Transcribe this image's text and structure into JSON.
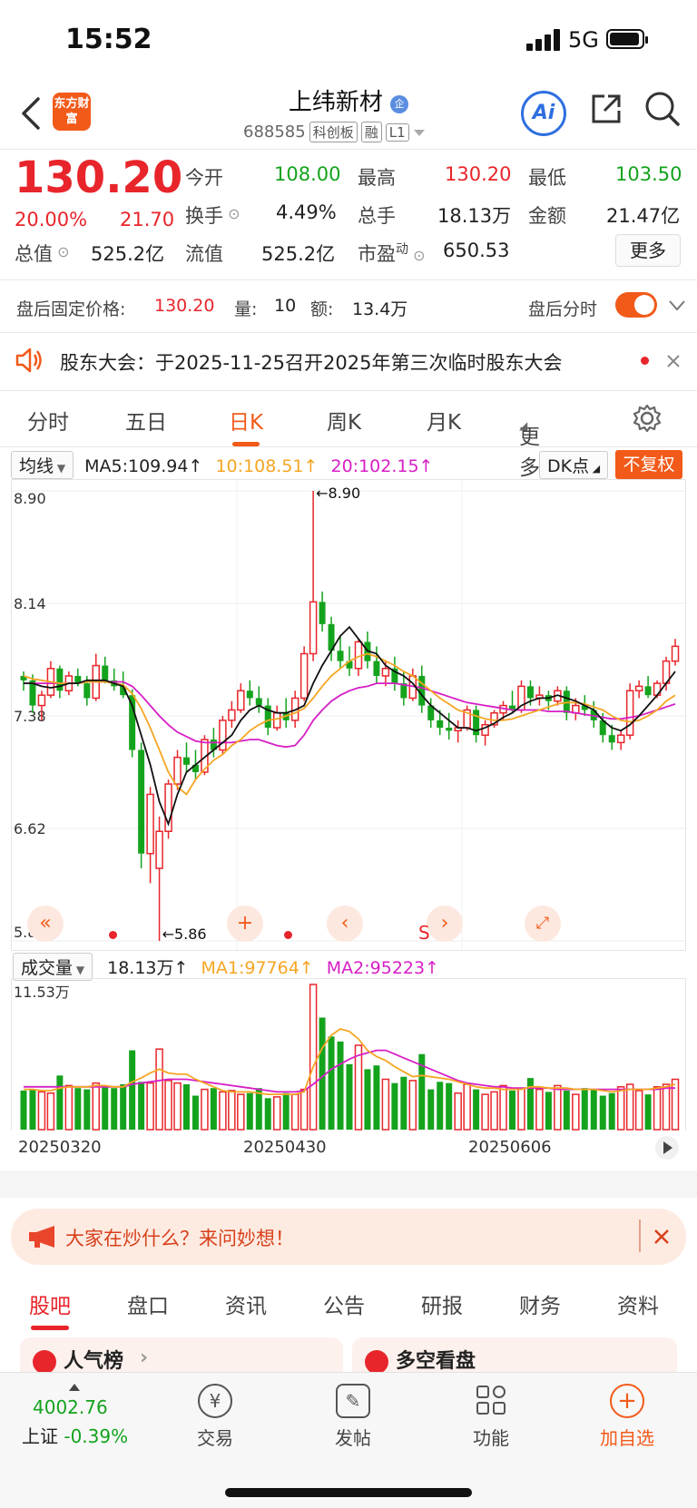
{
  "status_bar": {
    "time": "15:52",
    "network": "5G"
  },
  "header": {
    "logo_text": "东方财富",
    "title": "上纬新材",
    "badge": "企",
    "code": "688585",
    "tags": [
      "科创板",
      "融",
      "L1"
    ]
  },
  "quote": {
    "price": "130.20",
    "change_pct": "20.00%",
    "change": "21.70",
    "fields": [
      {
        "label": "今开",
        "value": "108.00"
      },
      {
        "label": "最高",
        "value": "130.20"
      },
      {
        "label": "最低",
        "value": "103.50"
      },
      {
        "label": "换手",
        "value": "4.49%"
      },
      {
        "label": "总手",
        "value": "18.13万"
      },
      {
        "label": "金额",
        "value": "21.47亿"
      },
      {
        "label": "总值",
        "value": "525.2亿"
      },
      {
        "label": "流值",
        "value": "525.2亿"
      },
      {
        "label": "市盈",
        "sup": "动",
        "value": "650.53"
      }
    ],
    "more_label": "更多"
  },
  "after_hours": {
    "label": "盘后固定价格:",
    "price": "130.20",
    "vol_label": "量:",
    "vol": "10",
    "amt_label": "额:",
    "amt": "13.4万",
    "toggle_label": "盘后分时"
  },
  "notice": {
    "text": "股东大会：于2025-11-25召开2025年第三次临时股东大会"
  },
  "tabs": [
    "分时",
    "五日",
    "日K",
    "周K",
    "月K",
    "更多"
  ],
  "active_tab": "日K",
  "ma_legend": {
    "selector": "均线",
    "ma5": "MA5:109.94↑",
    "ma10": "10:108.51↑",
    "ma20": "20:102.15↑",
    "dk": "DK点",
    "fq": "不复权"
  },
  "vol_legend": {
    "selector": "成交量",
    "value": "18.13万↑",
    "ma1": "MA1:97764↑",
    "ma2": "MA2:95223↑"
  },
  "chart_data": {
    "type": "candlestick",
    "y_ticks": [
      "8.90",
      "8.14",
      "7.38",
      "6.62",
      "5.86"
    ],
    "ylim": [
      5.86,
      8.9
    ],
    "annotations": {
      "high": "←8.90",
      "low": "←5.86"
    },
    "vol_max_label": "11.53万",
    "x_ticks": [
      "20250320",
      "20250430",
      "20250606"
    ],
    "candles": [
      [
        7.65,
        7.68,
        7.55,
        7.62
      ],
      [
        7.62,
        7.66,
        7.4,
        7.45
      ],
      [
        7.45,
        7.55,
        7.35,
        7.52
      ],
      [
        7.52,
        7.75,
        7.5,
        7.7
      ],
      [
        7.7,
        7.72,
        7.5,
        7.55
      ],
      [
        7.55,
        7.68,
        7.52,
        7.65
      ],
      [
        7.65,
        7.7,
        7.58,
        7.6
      ],
      [
        7.6,
        7.65,
        7.45,
        7.5
      ],
      [
        7.5,
        7.8,
        7.48,
        7.72
      ],
      [
        7.72,
        7.78,
        7.6,
        7.62
      ],
      [
        7.62,
        7.7,
        7.55,
        7.58
      ],
      [
        7.58,
        7.68,
        7.5,
        7.52
      ],
      [
        7.52,
        7.56,
        7.1,
        7.15
      ],
      [
        7.15,
        7.2,
        6.35,
        6.45
      ],
      [
        6.45,
        6.9,
        6.25,
        6.85
      ],
      [
        6.35,
        6.7,
        5.86,
        6.6
      ],
      [
        6.6,
        6.95,
        6.55,
        6.92
      ],
      [
        6.92,
        7.15,
        6.88,
        7.1
      ],
      [
        7.1,
        7.2,
        7.0,
        7.05
      ],
      [
        7.05,
        7.15,
        6.95,
        7.0
      ],
      [
        7.0,
        7.25,
        6.98,
        7.22
      ],
      [
        7.22,
        7.3,
        7.1,
        7.15
      ],
      [
        7.15,
        7.38,
        7.12,
        7.35
      ],
      [
        7.35,
        7.48,
        7.3,
        7.42
      ],
      [
        7.42,
        7.6,
        7.4,
        7.55
      ],
      [
        7.55,
        7.62,
        7.45,
        7.5
      ],
      [
        7.5,
        7.58,
        7.4,
        7.45
      ],
      [
        7.45,
        7.5,
        7.25,
        7.3
      ],
      [
        7.3,
        7.45,
        7.28,
        7.4
      ],
      [
        7.4,
        7.5,
        7.3,
        7.35
      ],
      [
        7.35,
        7.55,
        7.3,
        7.5
      ],
      [
        7.5,
        7.85,
        7.48,
        7.8
      ],
      [
        7.8,
        8.9,
        7.75,
        8.15
      ],
      [
        8.15,
        8.22,
        7.95,
        8.0
      ],
      [
        8.0,
        8.05,
        7.75,
        7.82
      ],
      [
        7.82,
        7.92,
        7.7,
        7.75
      ],
      [
        7.75,
        7.85,
        7.65,
        7.7
      ],
      [
        7.7,
        7.9,
        7.65,
        7.88
      ],
      [
        7.88,
        7.95,
        7.7,
        7.75
      ],
      [
        7.75,
        7.85,
        7.6,
        7.65
      ],
      [
        7.65,
        7.75,
        7.58,
        7.7
      ],
      [
        7.7,
        7.78,
        7.55,
        7.6
      ],
      [
        7.6,
        7.68,
        7.45,
        7.5
      ],
      [
        7.5,
        7.7,
        7.48,
        7.65
      ],
      [
        7.65,
        7.72,
        7.4,
        7.45
      ],
      [
        7.45,
        7.5,
        7.3,
        7.35
      ],
      [
        7.35,
        7.42,
        7.25,
        7.3
      ],
      [
        7.3,
        7.4,
        7.22,
        7.28
      ],
      [
        7.28,
        7.35,
        7.2,
        7.3
      ],
      [
        7.3,
        7.45,
        7.28,
        7.42
      ],
      [
        7.42,
        7.45,
        7.2,
        7.25
      ],
      [
        7.25,
        7.35,
        7.18,
        7.32
      ],
      [
        7.32,
        7.42,
        7.3,
        7.4
      ],
      [
        7.4,
        7.48,
        7.35,
        7.45
      ],
      [
        7.45,
        7.55,
        7.4,
        7.42
      ],
      [
        7.42,
        7.62,
        7.4,
        7.58
      ],
      [
        7.58,
        7.62,
        7.45,
        7.5
      ],
      [
        7.5,
        7.58,
        7.45,
        7.52
      ],
      [
        7.52,
        7.55,
        7.42,
        7.48
      ],
      [
        7.48,
        7.58,
        7.45,
        7.55
      ],
      [
        7.55,
        7.58,
        7.35,
        7.4
      ],
      [
        7.4,
        7.5,
        7.35,
        7.45
      ],
      [
        7.45,
        7.52,
        7.38,
        7.42
      ],
      [
        7.42,
        7.48,
        7.3,
        7.35
      ],
      [
        7.35,
        7.4,
        7.2,
        7.25
      ],
      [
        7.25,
        7.32,
        7.15,
        7.2
      ],
      [
        7.2,
        7.28,
        7.15,
        7.25
      ],
      [
        7.25,
        7.6,
        7.22,
        7.55
      ],
      [
        7.55,
        7.62,
        7.5,
        7.58
      ],
      [
        7.58,
        7.65,
        7.5,
        7.52
      ],
      [
        7.52,
        7.62,
        7.5,
        7.6
      ],
      [
        7.6,
        7.78,
        7.55,
        7.75
      ],
      [
        7.75,
        7.9,
        7.72,
        7.85
      ]
    ],
    "volumes": [
      3.1,
      3.2,
      3.0,
      2.9,
      4.3,
      3.5,
      3.3,
      3.2,
      3.7,
      3.4,
      3.3,
      3.6,
      6.3,
      3.8,
      3.7,
      6.4,
      3.9,
      3.7,
      3.6,
      2.7,
      3.2,
      3.3,
      3.0,
      3.1,
      2.8,
      2.9,
      3.3,
      2.5,
      2.6,
      2.9,
      2.8,
      3.2,
      11.53,
      8.9,
      7.4,
      7.0,
      5.2,
      6.7,
      4.8,
      5.1,
      4.0,
      3.7,
      4.2,
      3.9,
      6.0,
      3.2,
      3.8,
      3.7,
      2.9,
      3.6,
      3.2,
      2.8,
      3.0,
      3.5,
      3.1,
      3.3,
      4.1,
      3.2,
      3.0,
      3.5,
      3.1,
      2.8,
      3.3,
      3.2,
      2.7,
      2.9,
      3.4,
      3.6,
      3.1,
      2.8,
      3.4,
      3.6,
      4.0
    ],
    "ma5": [
      7.6,
      7.6,
      7.58,
      7.57,
      7.58,
      7.6,
      7.6,
      7.62,
      7.62,
      7.62,
      7.6,
      7.58,
      7.45,
      7.25,
      7.05,
      6.8,
      6.65,
      6.85,
      7.0,
      7.05,
      7.1,
      7.15,
      7.2,
      7.25,
      7.35,
      7.42,
      7.45,
      7.42,
      7.4,
      7.4,
      7.42,
      7.45,
      7.6,
      7.72,
      7.82,
      7.92,
      7.98,
      7.9,
      7.82,
      7.8,
      7.72,
      7.68,
      7.65,
      7.6,
      7.52,
      7.45,
      7.4,
      7.35,
      7.3,
      7.3,
      7.28,
      7.3,
      7.33,
      7.37,
      7.4,
      7.45,
      7.48,
      7.5,
      7.5,
      7.52,
      7.5,
      7.48,
      7.45,
      7.42,
      7.35,
      7.3,
      7.28,
      7.32,
      7.38,
      7.45,
      7.52,
      7.6,
      7.68
    ],
    "ma10": [
      7.65,
      7.63,
      7.62,
      7.61,
      7.6,
      7.6,
      7.6,
      7.61,
      7.61,
      7.61,
      7.6,
      7.59,
      7.53,
      7.43,
      7.3,
      7.15,
      7.0,
      6.9,
      6.85,
      6.95,
      7.02,
      7.08,
      7.12,
      7.18,
      7.22,
      7.28,
      7.32,
      7.35,
      7.36,
      7.38,
      7.4,
      7.43,
      7.5,
      7.58,
      7.65,
      7.7,
      7.75,
      7.78,
      7.8,
      7.78,
      7.75,
      7.72,
      7.68,
      7.65,
      7.6,
      7.55,
      7.5,
      7.46,
      7.42,
      7.4,
      7.38,
      7.36,
      7.35,
      7.35,
      7.36,
      7.38,
      7.4,
      7.42,
      7.44,
      7.46,
      7.47,
      7.47,
      7.46,
      7.44,
      7.42,
      7.38,
      7.35,
      7.34,
      7.35,
      7.38,
      7.42,
      7.48,
      7.52
    ],
    "ma20": [
      7.6,
      7.6,
      7.6,
      7.6,
      7.6,
      7.6,
      7.6,
      7.61,
      7.61,
      7.61,
      7.61,
      7.61,
      7.58,
      7.52,
      7.45,
      7.38,
      7.32,
      7.27,
      7.24,
      7.21,
      7.2,
      7.2,
      7.2,
      7.2,
      7.21,
      7.22,
      7.22,
      7.2,
      7.18,
      7.17,
      7.18,
      7.25,
      7.35,
      7.42,
      7.48,
      7.52,
      7.55,
      7.57,
      7.58,
      7.6,
      7.6,
      7.6,
      7.59,
      7.58,
      7.57,
      7.55,
      7.53,
      7.51,
      7.49,
      7.47,
      7.46,
      7.45,
      7.44,
      7.43,
      7.42,
      7.42,
      7.42,
      7.42,
      7.41,
      7.41,
      7.41,
      7.4,
      7.39,
      7.38,
      7.37,
      7.36,
      7.36,
      7.37,
      7.38,
      7.4,
      7.42,
      7.44,
      7.46
    ],
    "vol_ma1": [
      3.2,
      3.2,
      3.1,
      3.1,
      3.3,
      3.4,
      3.4,
      3.4,
      3.5,
      3.5,
      3.4,
      3.4,
      3.8,
      4.1,
      4.5,
      4.8,
      4.5,
      4.4,
      4.4,
      4.0,
      3.7,
      3.4,
      3.1,
      3.0,
      3.0,
      3.0,
      2.9,
      2.8,
      2.8,
      2.8,
      2.8,
      3.0,
      5.0,
      6.5,
      7.5,
      8.0,
      7.8,
      7.2,
      6.3,
      5.8,
      5.5,
      5.0,
      4.6,
      4.2,
      4.3,
      4.2,
      4.1,
      4.0,
      3.8,
      3.6,
      3.4,
      3.3,
      3.3,
      3.2,
      3.2,
      3.2,
      3.4,
      3.4,
      3.3,
      3.3,
      3.3,
      3.2,
      3.2,
      3.2,
      3.1,
      3.0,
      3.1,
      3.2,
      3.2,
      3.2,
      3.3,
      3.4,
      3.6
    ],
    "vol_ma2": [
      3.4,
      3.4,
      3.4,
      3.4,
      3.4,
      3.4,
      3.4,
      3.4,
      3.4,
      3.4,
      3.4,
      3.4,
      3.6,
      3.7,
      3.8,
      3.9,
      4.0,
      4.0,
      4.0,
      3.9,
      3.8,
      3.7,
      3.6,
      3.5,
      3.4,
      3.3,
      3.2,
      3.1,
      3.0,
      3.0,
      3.0,
      3.1,
      3.6,
      4.2,
      4.8,
      5.2,
      5.6,
      5.9,
      6.1,
      6.3,
      6.3,
      6.0,
      5.7,
      5.4,
      5.1,
      4.8,
      4.5,
      4.2,
      3.9,
      3.7,
      3.6,
      3.5,
      3.4,
      3.4,
      3.3,
      3.3,
      3.3,
      3.3,
      3.3,
      3.2,
      3.2,
      3.2,
      3.2,
      3.2,
      3.2,
      3.2,
      3.2,
      3.2,
      3.2,
      3.2,
      3.2,
      3.3,
      3.3
    ]
  },
  "ask": {
    "text": "大家在炒什么？来问妙想！"
  },
  "subtabs": [
    "股吧",
    "盘口",
    "资讯",
    "公告",
    "研报",
    "财务",
    "资料"
  ],
  "peek": {
    "left": "人气榜",
    "right": "多空看盘"
  },
  "bottom_nav": {
    "index_value": "4002.76",
    "index_name": "上证",
    "index_change": "-0.39%",
    "items": [
      "交易",
      "发帖",
      "功能",
      "加自选"
    ]
  },
  "colors": {
    "up": "#e8252b",
    "down": "#14a31d",
    "ma5": "#111111",
    "ma10": "#f5a623",
    "ma20": "#d71ec6",
    "accent": "#f25a1a"
  }
}
